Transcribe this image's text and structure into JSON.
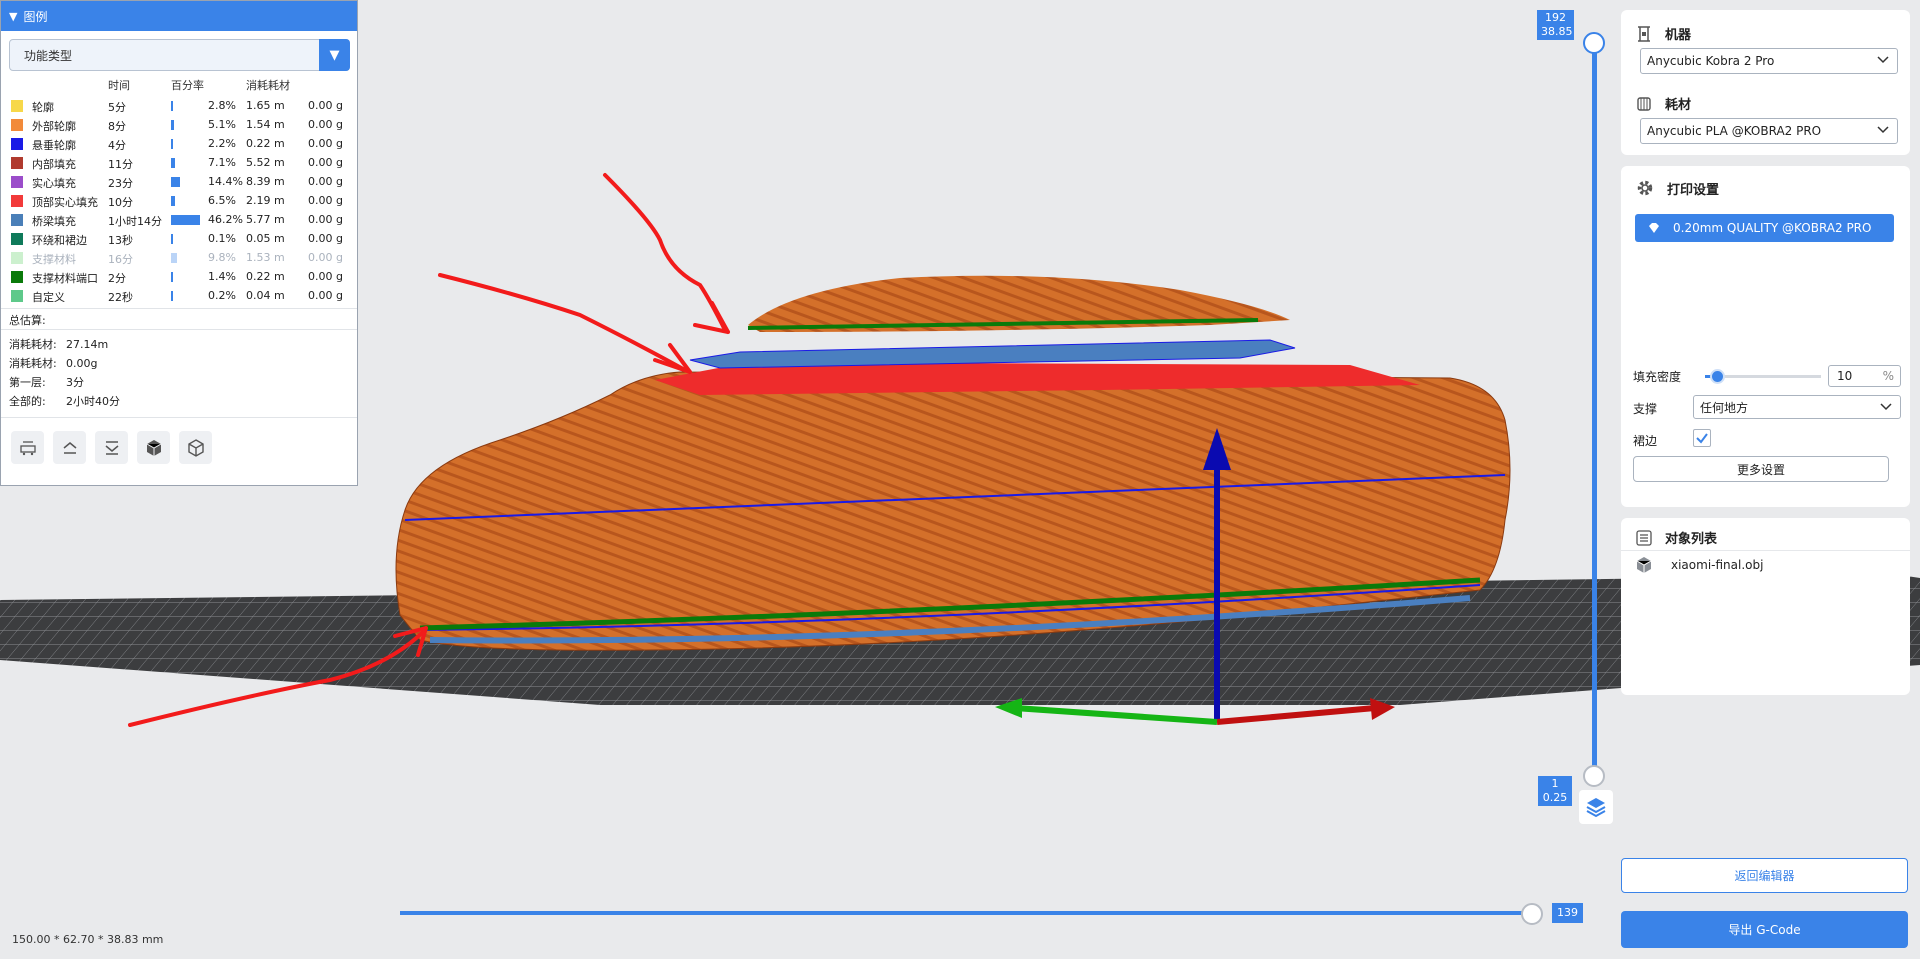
{
  "legend": {
    "title": "图例",
    "type_select": "功能类型",
    "columns": {
      "time": "时间",
      "percent": "百分率",
      "usage": "消耗耗材"
    },
    "rows": [
      {
        "name": "轮廓",
        "time": "5分",
        "percent": "2.8%",
        "length": "1.65 m",
        "weight": "0.00 g",
        "color": "#f7d84a",
        "ratio": 0.028,
        "dim": false
      },
      {
        "name": "外部轮廓",
        "time": "8分",
        "percent": "5.1%",
        "length": "1.54 m",
        "weight": "0.00 g",
        "color": "#f28a3a",
        "ratio": 0.051,
        "dim": false
      },
      {
        "name": "悬垂轮廓",
        "time": "4分",
        "percent": "2.2%",
        "length": "0.22 m",
        "weight": "0.00 g",
        "color": "#1a1ae6",
        "ratio": 0.022,
        "dim": false
      },
      {
        "name": "内部填充",
        "time": "11分",
        "percent": "7.1%",
        "length": "5.52 m",
        "weight": "0.00 g",
        "color": "#b03a2e",
        "ratio": 0.071,
        "dim": false
      },
      {
        "name": "实心填充",
        "time": "23分",
        "percent": "14.4%",
        "length": "8.39 m",
        "weight": "0.00 g",
        "color": "#9b4dca",
        "ratio": 0.144,
        "dim": false
      },
      {
        "name": "顶部实心填充",
        "time": "10分",
        "percent": "6.5%",
        "length": "2.19 m",
        "weight": "0.00 g",
        "color": "#f23a3a",
        "ratio": 0.065,
        "dim": false
      },
      {
        "name": "桥梁填充",
        "time": "1小时14分",
        "percent": "46.2%",
        "length": "5.77 m",
        "weight": "0.00 g",
        "color": "#4a7fb8",
        "ratio": 0.462,
        "dim": false
      },
      {
        "name": "环绕和裙边",
        "time": "13秒",
        "percent": "0.1%",
        "length": "0.05 m",
        "weight": "0.00 g",
        "color": "#0f7a5a",
        "ratio": 0.001,
        "dim": false
      },
      {
        "name": "支撑材料",
        "time": "16分",
        "percent": "9.8%",
        "length": "1.53 m",
        "weight": "0.00 g",
        "color": "#b7eab9",
        "ratio": 0.098,
        "dim": true
      },
      {
        "name": "支撑材料端口",
        "time": "2分",
        "percent": "1.4%",
        "length": "0.22 m",
        "weight": "0.00 g",
        "color": "#0a7a0a",
        "ratio": 0.014,
        "dim": false
      },
      {
        "name": "自定义",
        "time": "22秒",
        "percent": "0.2%",
        "length": "0.04 m",
        "weight": "0.00 g",
        "color": "#5ec98a",
        "ratio": 0.002,
        "dim": false
      }
    ],
    "totals_title": "总估算:",
    "totals": [
      {
        "label": "消耗耗材:",
        "value": "27.14m"
      },
      {
        "label": "消耗耗材:",
        "value": "0.00g"
      },
      {
        "label": "第一层:",
        "value": "3分"
      },
      {
        "label": "全部的:",
        "value": "2小时40分"
      }
    ]
  },
  "layer_slider": {
    "top_layer": "192",
    "top_height": "38.85",
    "bottom_layer": "1",
    "bottom_height": "0.25"
  },
  "move_slider": {
    "value": "139"
  },
  "dimensions": "150.00 * 62.70 * 38.83 mm",
  "machine": {
    "title": "机器",
    "value": "Anycubic Kobra 2 Pro"
  },
  "filament": {
    "title": "耗材",
    "value": "Anycubic PLA @KOBRA2 PRO"
  },
  "print_settings": {
    "title": "打印设置",
    "preset": "0.20mm QUALITY @KOBRA2 PRO",
    "infill_label": "填充密度",
    "infill_value": "10",
    "infill_unit": "%",
    "infill_ratio": 0.1,
    "support_label": "支撑",
    "support_value": "任何地方",
    "brim_label": "裙边",
    "brim_checked": true,
    "more_label": "更多设置"
  },
  "objects": {
    "title": "对象列表",
    "items": [
      "xiaomi-final.obj"
    ]
  },
  "back_button": "返回编辑器",
  "export_button": "导出 G-Code",
  "colors": {
    "accent": "#3a83e8",
    "model_orange": "#d9742e",
    "annotation_red": "#f21b1b"
  }
}
